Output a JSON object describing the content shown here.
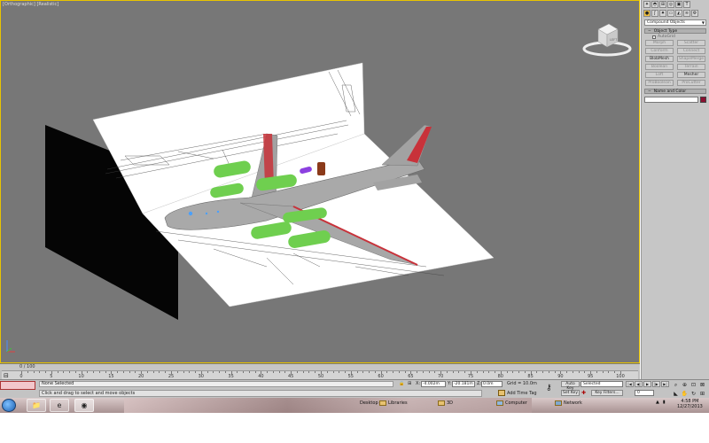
{
  "viewport": {
    "label": "[Orthographic] [Realistic]",
    "navcube_face": "LEFT",
    "axis_labels": [
      "z",
      "x",
      "y"
    ]
  },
  "command_panel": {
    "tab_icons": [
      "create-icon",
      "modify-icon",
      "hierarchy-icon",
      "motion-icon",
      "display-icon",
      "utilities-icon"
    ],
    "subtab_icons": [
      "geometry-icon",
      "shapes-icon",
      "lights-icon",
      "cameras-icon",
      "helpers-icon",
      "spacewarps-icon",
      "systems-icon"
    ],
    "category": "Compound Objects",
    "object_type_title": "Object Type",
    "autogrid_label": "AutoGrid",
    "buttons": [
      {
        "label": "Morph",
        "active": false
      },
      {
        "label": "Scatter",
        "active": false
      },
      {
        "label": "Conform",
        "active": false
      },
      {
        "label": "Connect",
        "active": false
      },
      {
        "label": "BlobMesh",
        "active": true
      },
      {
        "label": "ShapeMerge",
        "active": false
      },
      {
        "label": "Boolean",
        "active": false
      },
      {
        "label": "Terrain",
        "active": false
      },
      {
        "label": "Loft",
        "active": false
      },
      {
        "label": "Mesher",
        "active": true
      },
      {
        "label": "ProBoolean",
        "active": false
      },
      {
        "label": "ProCutter",
        "active": false
      }
    ],
    "name_color_title": "Name and Color",
    "name_value": "",
    "object_color": "#8b1030"
  },
  "timeline": {
    "frame_label": "0 / 100",
    "ticks": [
      0,
      5,
      10,
      15,
      20,
      25,
      30,
      35,
      40,
      45,
      50,
      55,
      60,
      65,
      70,
      75,
      80,
      85,
      90,
      95,
      100
    ]
  },
  "status": {
    "selection": "None Selected",
    "prompt": "Click and drag to select and move objects",
    "x_label": "X:",
    "x_value": "-4.002m",
    "y_label": "Y:",
    "y_value": "-20.181m",
    "z_label": "Z:",
    "z_value": "0.0m",
    "grid": "Grid = 10.0m",
    "add_time_tag": "Add Time Tag",
    "auto_key": "Auto Key",
    "selected_dropdown": "Selected",
    "set_key": "Set Key",
    "key_filters": "Key Filters...",
    "frame": "0"
  },
  "taskbar": {
    "desktop": "Desktop",
    "links": [
      "Libraries",
      "3D",
      "Computer",
      "Network"
    ],
    "time": "4:58 PM",
    "date": "12/27/2013"
  },
  "colors": {
    "viewport_bg": "#777777",
    "panel_bg": "#c6c6c6",
    "fuselage": "#a0a0a0",
    "engine": "#6fcf4f",
    "accent_red": "#c8323a"
  }
}
